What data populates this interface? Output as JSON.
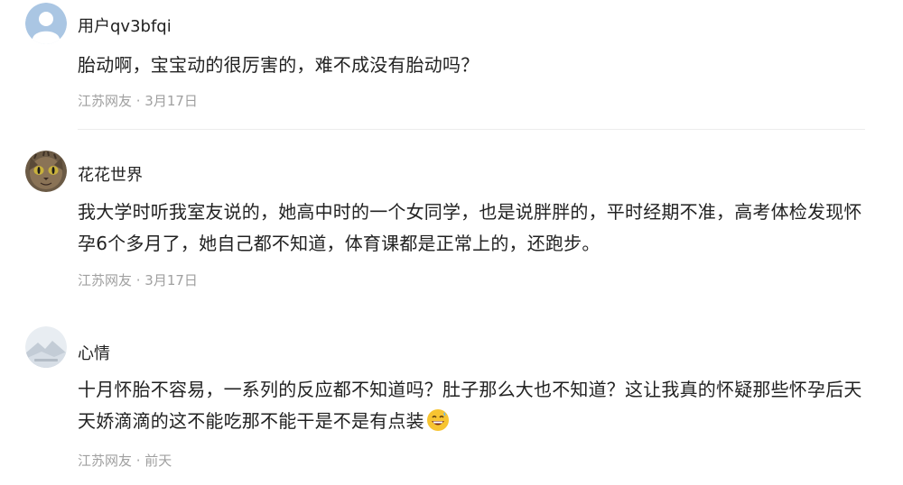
{
  "comments": [
    {
      "username": "用户qv3bfqi",
      "content": "胎动啊，宝宝动的很厉害的，难不成没有胎动吗？",
      "meta": "江苏网友 · 3月17日",
      "avatar": "default-user-avatar"
    },
    {
      "username": "花花世界",
      "content": "我大学时听我室友说的，她高中时的一个女同学，也是说胖胖的，平时经期不准，高考体检发现怀孕6个多月了，她自己都不知道，体育课都是正常上的，还跑步。",
      "meta": "江苏网友 · 3月17日",
      "avatar": "cat-avatar"
    },
    {
      "username": "心情",
      "content": "十月怀胎不容易，一系列的反应都不知道吗？肚子那么大也不知道？这让我真的怀疑那些怀孕后天天娇滴滴的这不能吃那不能干是不是有点装",
      "meta": "江苏网友 · 前天",
      "avatar": "landscape-avatar",
      "emoji": "grinning-sweat-emoji"
    }
  ],
  "colors": {
    "text": "#222222",
    "meta": "#a0a0a0",
    "divider": "#ececec",
    "default_avatar": "#a9c4e0"
  }
}
